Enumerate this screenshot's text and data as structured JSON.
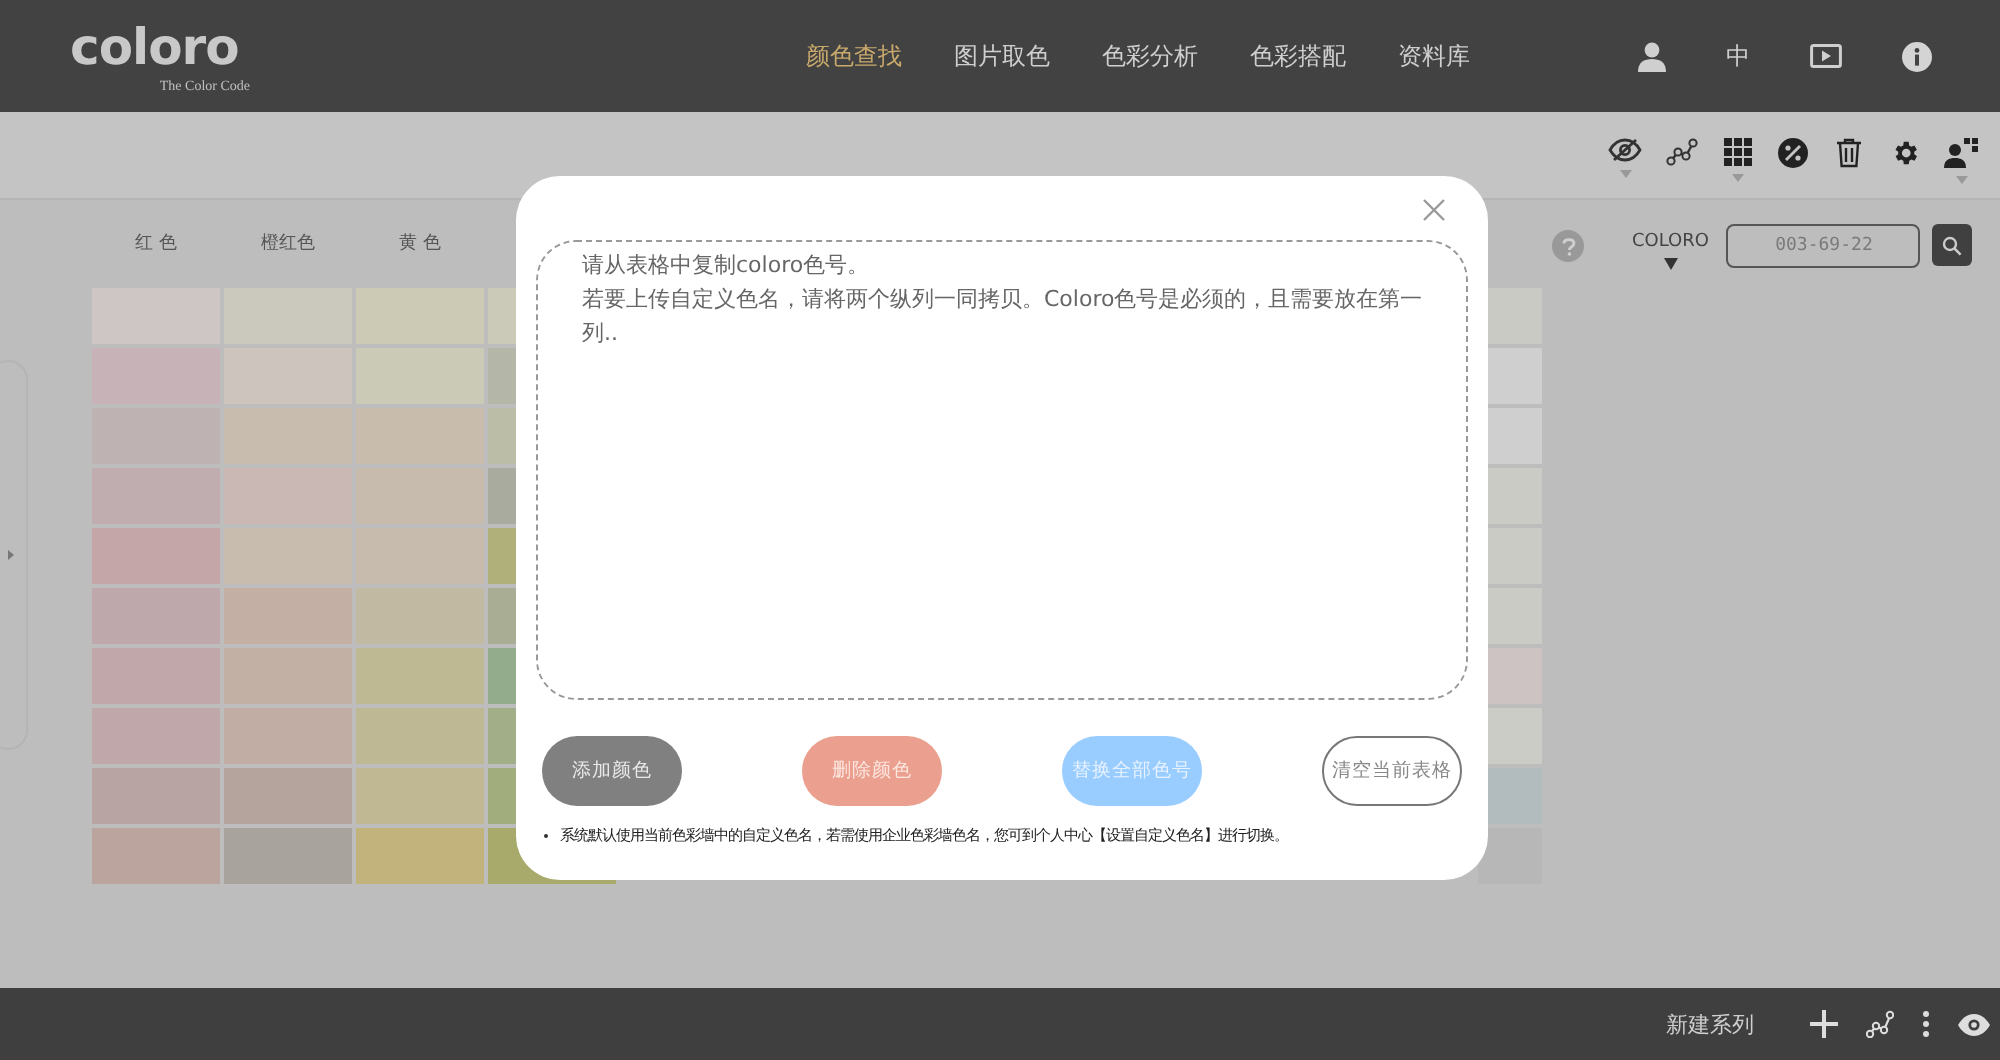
{
  "header": {
    "logo": "coloro",
    "tagline": "The Color Code",
    "nav": [
      {
        "label": "颜色查找",
        "selected": true
      },
      {
        "label": "图片取色",
        "selected": false
      },
      {
        "label": "色彩分析",
        "selected": false
      },
      {
        "label": "色彩搭配",
        "selected": false
      },
      {
        "label": "资料库",
        "selected": false
      }
    ],
    "language": "中"
  },
  "search": {
    "brand": "COLORO",
    "placeholder": "003-69-22"
  },
  "palette": {
    "columns": [
      {
        "heading": "红 色",
        "swatches": [
          {
            "color": "#cdc6c4"
          },
          {
            "color": "#c7b3b7"
          },
          {
            "color": "#bfb2b2"
          },
          {
            "color": "#bfadb0"
          },
          {
            "color": "#c4a6a8"
          },
          {
            "color": "#bfa8ab"
          },
          {
            "color": "#c2a7aa"
          },
          {
            "color": "#c0a8aa"
          },
          {
            "color": "#b9a4a4"
          },
          {
            "color": "#bba39e"
          }
        ]
      },
      {
        "heading": "橙红色",
        "swatches": [
          {
            "color": "#cbc8bd"
          },
          {
            "color": "#ccc4bd"
          },
          {
            "color": "#c8bcae"
          },
          {
            "color": "#c9b8b4"
          },
          {
            "color": "#c8bcae"
          },
          {
            "color": "#c4afa5"
          },
          {
            "color": "#c3b0a5"
          },
          {
            "color": "#c2ada4"
          },
          {
            "color": "#b5a49e"
          },
          {
            "color": "#a8a39d"
          }
        ]
      },
      {
        "heading": "黄 色",
        "swatches": [
          {
            "color": "#cccab4"
          },
          {
            "color": "#cbcab6"
          },
          {
            "color": "#c8bcac"
          },
          {
            "color": "#c6bbac"
          },
          {
            "color": "#c6bbac"
          },
          {
            "color": "#c2b9a2"
          },
          {
            "color": "#bfb993"
          },
          {
            "color": "#bfb894"
          },
          {
            "color": "#bfb893"
          },
          {
            "color": "#c2b27b"
          }
        ]
      },
      {
        "swatches": [
          {
            "color": "#cbcab8"
          },
          {
            "color": "#b4b6a8"
          },
          {
            "color": "#bcbda6"
          },
          {
            "color": "#a9ab9f"
          },
          {
            "color": "#b0b07a"
          },
          {
            "color": "#a9ad94"
          },
          {
            "color": "#93ad8c"
          },
          {
            "color": "#a2ae88"
          },
          {
            "color": "#a2ad7d"
          },
          {
            "color": "#a8aa6c"
          }
        ]
      }
    ],
    "right_column": {
      "swatches": [
        {
          "color": "#cacac4"
        },
        {
          "color": "#cfcfcf"
        },
        {
          "color": "#cfcfcf"
        },
        {
          "color": "#cacbc4"
        },
        {
          "color": "#cacbc5"
        },
        {
          "color": "#cbcbc5"
        },
        {
          "color": "#cdc3c2"
        },
        {
          "color": "#cbccc6"
        },
        {
          "color": "#b2bbbe"
        },
        {
          "color": "#b7b7b7"
        }
      ]
    }
  },
  "dialog": {
    "placeholder_lines": [
      "请从表格中复制coloro色号。",
      "若要上传自定义色名，请将两个纵列一同拷贝。Coloro色号是必须的，且需要放在第一列.."
    ],
    "buttons": [
      {
        "label": "添加颜色",
        "kind": "add"
      },
      {
        "label": "删除颜色",
        "kind": "delete"
      },
      {
        "label": "替换全部色号",
        "kind": "replace"
      },
      {
        "label": "清空当前表格",
        "kind": "clear"
      }
    ],
    "note": "系统默认使用当前色彩墙中的自定义色名，若需使用企业色彩墙色名，您可到个人中心【设置自定义色名】进行切换。"
  },
  "footer": {
    "new_series": "新建系列"
  }
}
